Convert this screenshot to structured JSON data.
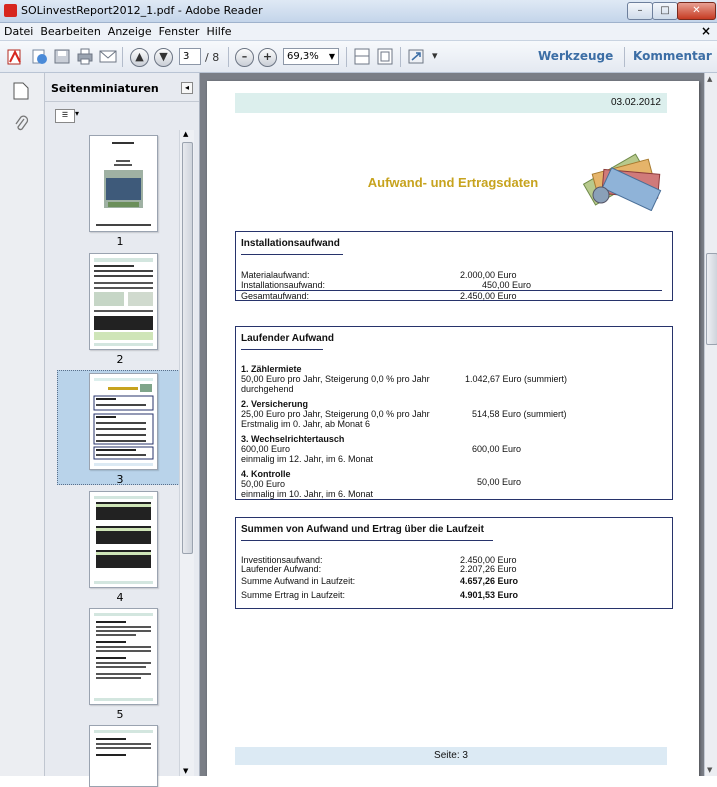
{
  "window": {
    "title": "SOLinvestReport2012_1.pdf - Adobe Reader",
    "minimize": "–",
    "maximize": "□",
    "close": "✕"
  },
  "menu": {
    "items": [
      "Datei",
      "Bearbeiten",
      "Anzeige",
      "Fenster",
      "Hilfe"
    ],
    "close": "×"
  },
  "toolbar": {
    "page_current": "3",
    "page_total": "/ 8",
    "zoom": "69,3%",
    "minus": "–",
    "plus": "+",
    "tools_label": "Werkzeuge",
    "comment_label": "Kommentar"
  },
  "thumbnails": {
    "header": "Seitenminiaturen",
    "pages": [
      "1",
      "2",
      "3",
      "4",
      "5"
    ],
    "selected": "3"
  },
  "document": {
    "date": "03.02.2012",
    "heading": "Aufwand- und Ertragsdaten",
    "installation": {
      "title": "Installationsaufwand",
      "rows": [
        {
          "label": "Materialaufwand:",
          "value": "2.000,00 Euro"
        },
        {
          "label": "Installationsaufwand:",
          "value": "450,00 Euro"
        },
        {
          "label": "Gesamtaufwand:",
          "value": "2.450,00 Euro"
        }
      ]
    },
    "running": {
      "title": "Laufender Aufwand",
      "items": [
        {
          "name": "1. Zählermiete",
          "line1": "50,00 Euro pro Jahr, Steigerung 0,0 % pro Jahr",
          "line2": "durchgehend",
          "value": "1.042,67 Euro (summiert)"
        },
        {
          "name": "2. Versicherung",
          "line1": "25,00 Euro pro Jahr, Steigerung 0,0 % pro Jahr",
          "line2": "Erstmalig im 0. Jahr, ab Monat 6",
          "value": "514,58 Euro (summiert)"
        },
        {
          "name": "3. Wechselrichtertausch",
          "line1": "600,00 Euro",
          "line2": "einmalig im 12. Jahr, im 6. Monat",
          "value": "600,00 Euro"
        },
        {
          "name": "4. Kontrolle",
          "line1": "50,00 Euro",
          "line2": "einmalig im 10. Jahr, im 6. Monat",
          "value": "50,00 Euro"
        }
      ]
    },
    "sums": {
      "title": "Summen von Aufwand und Ertrag über die Laufzeit",
      "rows": [
        {
          "label": "Investitionsaufwand:",
          "value": "2.450,00 Euro"
        },
        {
          "label": "Laufender Aufwand:",
          "value": "2.207,26 Euro"
        },
        {
          "label": "Summe Aufwand in Laufzeit:",
          "value": "4.657,26 Euro"
        },
        {
          "label": "Summe Ertrag in Laufzeit:",
          "value": "4.901,53 Euro"
        }
      ]
    },
    "footer": "Seite: 3"
  },
  "colors": {
    "heading": "#c7a31e",
    "box_border": "#27336b",
    "selection": "#b9d3ea",
    "link": "#3c6ea5"
  }
}
